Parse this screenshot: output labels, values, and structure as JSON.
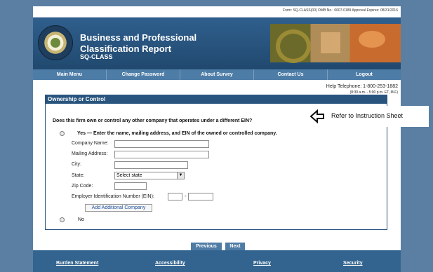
{
  "header": {
    "form_line": "Form: SQ-CLASS(00) OMB No.: 0607-0189 Approval Expires: 08/31/2016",
    "title_line1": "Business and Professional",
    "title_line2": "Classification Report",
    "title_line3": "SQ-CLASS",
    "seal_label": "U.S. DEPARTMENT OF COMMERCE BUREAU OF THE CENSUS"
  },
  "nav": [
    "Main Menu",
    "Change Password",
    "About Survey",
    "Contact Us",
    "Logout"
  ],
  "help": {
    "telephone": "Help Telephone: 1-800-253-1882",
    "hours": "(8:30 a.m. - 5:00 p.m. ET, M-F)"
  },
  "section": {
    "title": "Ownership or Control",
    "question": "Does this firm own or control any other company that operates under a different EIN?",
    "help_glyph": "?",
    "yes_label": "Yes — Enter the name, mailing address, and EIN of the owned or controlled company.",
    "fields": {
      "company_name": {
        "label": "Company Name:",
        "value": ""
      },
      "mailing_address": {
        "label": "Mailing Address:",
        "value": ""
      },
      "city": {
        "label": "City:",
        "value": ""
      },
      "state": {
        "label": "State:",
        "value": "Select state"
      },
      "zip": {
        "label": "Zip Code:",
        "value": ""
      },
      "ein": {
        "label": "Employer Identification Number (EIN):",
        "part1": "",
        "part2": ""
      }
    },
    "add_button": "Add Additional Company",
    "no_label": "No"
  },
  "buttons": {
    "previous": "Previous",
    "next": "Next"
  },
  "footer": {
    "burden": "Burden Statement",
    "accessibility": "Accessibility",
    "privacy": "Privacy",
    "security": "Security"
  },
  "callout": {
    "text": "Refer to Instruction Sheet"
  }
}
